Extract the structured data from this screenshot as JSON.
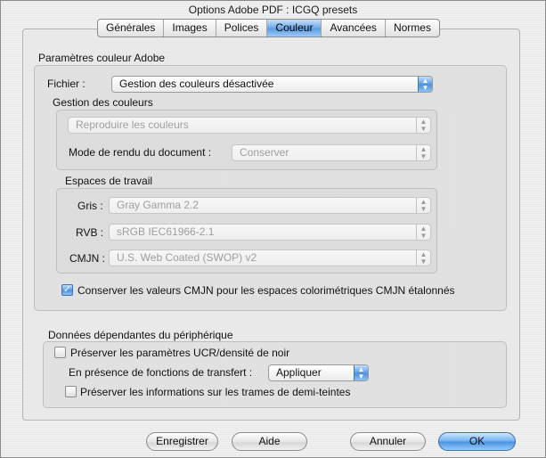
{
  "window": {
    "title": "Options Adobe PDF : ICGQ presets"
  },
  "tabs": [
    "Générales",
    "Images",
    "Polices",
    "Couleur",
    "Avancées",
    "Normes"
  ],
  "active_tab": "Couleur",
  "color_settings": {
    "section_title": "Paramètres couleur Adobe",
    "file_label": "Fichier :",
    "file_value": "Gestion des couleurs désactivée",
    "color_management": {
      "title": "Gestion des couleurs",
      "policy_value": "Reproduire les couleurs",
      "intent_label": "Mode de rendu du document :",
      "intent_value": "Conserver"
    },
    "working_spaces": {
      "title": "Espaces de travail",
      "gray_label": "Gris :",
      "gray_value": "Gray Gamma 2.2",
      "rgb_label": "RVB :",
      "rgb_value": "sRGB IEC61966-2.1",
      "cmyk_label": "CMJN :",
      "cmyk_value": "U.S. Web Coated (SWOP) v2"
    },
    "preserve_cmyk": {
      "checked": true,
      "label": "Conserver les valeurs CMJN pour les espaces colorimétriques CMJN étalonnés"
    }
  },
  "device_data": {
    "section_title": "Données dépendantes du périphérique",
    "preserve_ucr": {
      "checked": false,
      "label": "Préserver les paramètres UCR/densité de noir"
    },
    "transfer_label": "En présence de fonctions de transfert :",
    "transfer_value": "Appliquer",
    "preserve_halftone": {
      "checked": false,
      "label": "Préserver les informations sur les trames de demi-teintes"
    }
  },
  "buttons": {
    "save": "Enregistrer",
    "help": "Aide",
    "cancel": "Annuler",
    "ok": "OK"
  },
  "icons": {
    "popup_arrows": "up-down-arrows-icon",
    "checkmark": "checkmark-icon"
  }
}
